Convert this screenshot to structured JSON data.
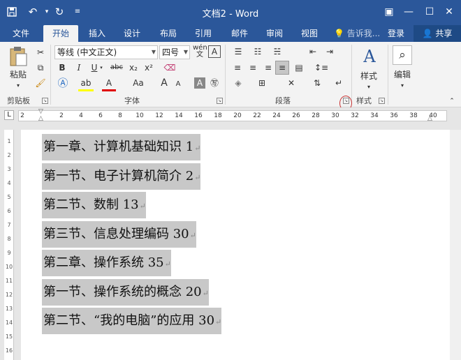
{
  "window": {
    "title": "文档2 - Word",
    "quick_access": {
      "save": "save-icon",
      "undo": "undo-icon",
      "redo": "redo-icon",
      "more": "customize-icon"
    },
    "controls": {
      "ribbon_options": "ribbon-display-icon",
      "minimize": "minimize-icon",
      "maximize": "maximize-icon",
      "close": "close-icon"
    }
  },
  "tabs": [
    "文件",
    "开始",
    "插入",
    "设计",
    "布局",
    "引用",
    "邮件",
    "审阅",
    "视图"
  ],
  "active_tab": "开始",
  "tell_me": "告诉我...",
  "login": "登录",
  "share": "共享",
  "ribbon": {
    "clipboard": {
      "paste_label": "粘贴",
      "group_label": "剪贴板"
    },
    "font": {
      "font_name": "等线 (中文正文)",
      "font_size": "四号",
      "bold": "B",
      "italic": "I",
      "underline": "U",
      "strike": "abc",
      "subscript": "x₂",
      "superscript": "x²",
      "grow": "A",
      "shrink": "A",
      "group_label": "字体"
    },
    "paragraph": {
      "group_label": "段落"
    },
    "styles": {
      "button_label": "样式",
      "group_label": "样式"
    },
    "editing": {
      "button_label": "编辑"
    }
  },
  "ruler": {
    "corner": "L",
    "ticks": [
      "2",
      "2",
      "4",
      "6",
      "8",
      "10",
      "12",
      "14",
      "16",
      "18",
      "20",
      "22",
      "24",
      "26",
      "28",
      "30",
      "32",
      "34",
      "36",
      "38",
      "40"
    ]
  },
  "vruler_ticks": [
    "1",
    "2",
    "3",
    "4",
    "5",
    "6",
    "7",
    "8",
    "9",
    "10",
    "11",
    "12",
    "13",
    "14",
    "15",
    "16"
  ],
  "document": {
    "lines": [
      {
        "text": "第一章、计算机基础知识  1"
      },
      {
        "text": "第一节、电子计算机简介  2"
      },
      {
        "text": "第二节、数制    13"
      },
      {
        "text": "第三节、信息处理编码 30"
      },
      {
        "text": "第二章、操作系统   35"
      },
      {
        "text": "第一节、操作系统的概念  20"
      },
      {
        "text": "第二节、“我的电脑”的应用 30"
      }
    ],
    "paragraph_mark": "↵",
    "selection_color": "#c8c8c8"
  },
  "colors": {
    "brand": "#2b579a",
    "annotation": "#c83232"
  }
}
